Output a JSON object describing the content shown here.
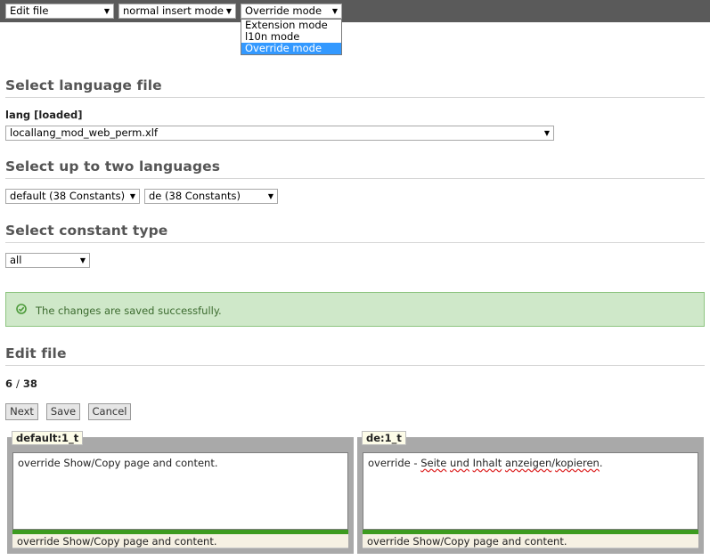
{
  "toolbar": {
    "function_select": "Edit file",
    "insert_mode_select": "normal insert mode",
    "mode_select": "Override mode",
    "mode_options": [
      "Extension mode",
      "l10n mode",
      "Override mode"
    ]
  },
  "language_file": {
    "heading": "Select language file",
    "label": "lang [loaded]",
    "selected_file": "locallang_mod_web_perm.xlf"
  },
  "languages": {
    "heading": "Select up to two languages",
    "first": "default (38 Constants)",
    "second": "de (38 Constants)"
  },
  "constant_type": {
    "heading": "Select constant type",
    "selected": "all"
  },
  "alert": {
    "message": "The changes are saved successfully.",
    "color": "#cfe8c9"
  },
  "edit_file": {
    "heading": "Edit file",
    "position": "6",
    "separator": "/",
    "total": "38",
    "buttons": {
      "next": "Next",
      "save": "Save",
      "cancel": "Cancel"
    }
  },
  "panels": {
    "left": {
      "tab": "default:1_t",
      "value": "override Show/Copy page and content.",
      "original": "override Show/Copy page and content."
    },
    "right": {
      "tab": "de:1_t",
      "value_prefix": "override - ",
      "value_words": [
        "Seite",
        "und",
        "Inhalt",
        "anzeigen",
        "kopieren"
      ],
      "value_separators": [
        " ",
        " ",
        " ",
        "/",
        "."
      ],
      "original": "override Show/Copy page and content."
    }
  }
}
